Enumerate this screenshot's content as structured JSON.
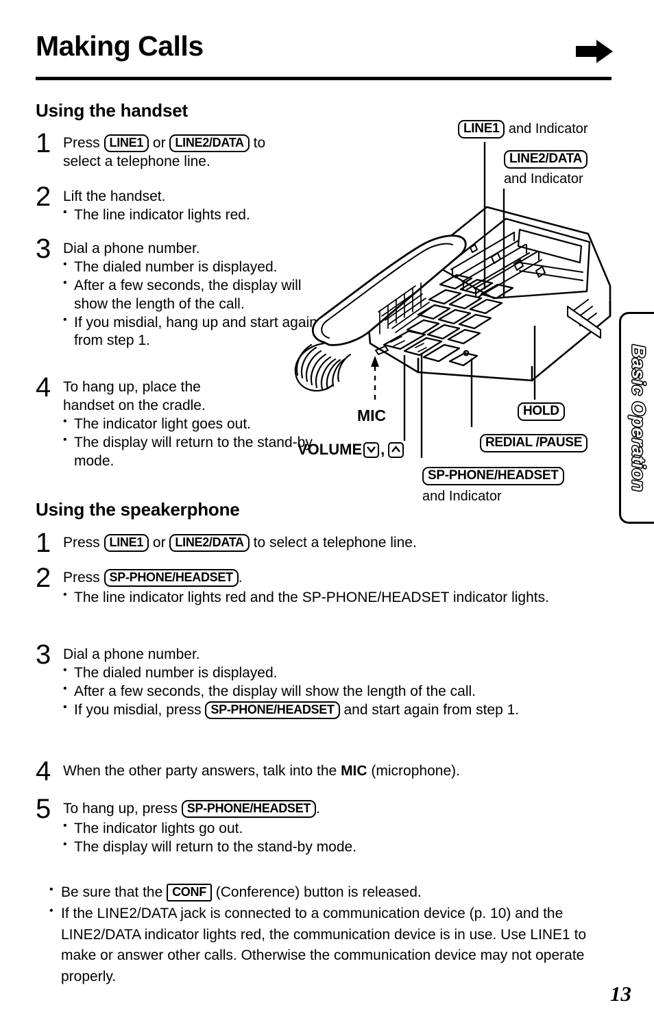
{
  "page": {
    "title": "Making Calls",
    "number": "13",
    "arrow_icon": "right-arrow-icon",
    "side_tab_label": "Basic Operation"
  },
  "handset": {
    "heading": "Using the handset",
    "steps": [
      {
        "num": "1",
        "line1_a": "Press",
        "key1": "LINE1",
        "line1_b": "or",
        "key2": "LINE2/DATA",
        "line1_c": "to",
        "line2": "select a telephone line.",
        "bullets": []
      },
      {
        "num": "2",
        "text": "Lift the handset.",
        "bullets": [
          "The line indicator lights red."
        ]
      },
      {
        "num": "3",
        "text": "Dial a phone number.",
        "bullets": [
          "The dialed number is displayed.",
          "After a few seconds, the display will show the length of the call.",
          "If you misdial, hang up and start again from step 1."
        ]
      },
      {
        "num": "4",
        "text": "To hang up, place the handset on the cradle.",
        "bullets": [
          "The indicator light goes out.",
          "The display will return to the stand-by mode."
        ]
      }
    ]
  },
  "speakerphone": {
    "heading": "Using the speakerphone",
    "steps": [
      {
        "num": "1",
        "a": "Press",
        "key1": "LINE1",
        "b": "or",
        "key2": "LINE2/DATA",
        "c": "to select a telephone line.",
        "bullets": []
      },
      {
        "num": "2",
        "a": "Press",
        "key1": "SP-PHONE/HEADSET",
        "c": ".",
        "bullets": [
          "The line indicator lights red and the SP-PHONE/HEADSET indicator lights."
        ]
      },
      {
        "num": "3",
        "text": "Dial a phone number.",
        "bullets": [
          "The dialed number is displayed.",
          "After a few seconds, the display will show the length of the call."
        ],
        "bullet_with_key": {
          "a": "If you misdial, press",
          "key1": "SP-PHONE/HEADSET",
          "c": "and start again from step 1."
        }
      },
      {
        "num": "4",
        "text_a": "When the other party answers, talk into the",
        "bold": "MIC",
        "text_b": "(microphone).",
        "bullets": []
      },
      {
        "num": "5",
        "a": "To hang up, press",
        "key1": "SP-PHONE/HEADSET",
        "c": ".",
        "bullets": [
          "The indicator lights go out.",
          "The display will return to the stand-by mode."
        ]
      }
    ]
  },
  "notes": {
    "note1_a": "Be sure that the",
    "note1_key": "CONF",
    "note1_b": "(Conference) button is released.",
    "note2": "If the LINE2/DATA jack is connected to a communication device (p. 10) and the LINE2/DATA indicator lights red, the communication device is in use. Use LINE1 to make or answer other calls. Otherwise the communication device may not operate properly."
  },
  "diagram": {
    "callouts": {
      "line1_key": "LINE1",
      "line1_suffix": "and Indicator",
      "line2_key": "LINE2/DATA",
      "line2_suffix": "and Indicator",
      "mic": "MIC",
      "volume": "VOLUME",
      "volume_down_icon": "volume-down-icon",
      "volume_up_icon": "volume-up-icon",
      "hold_key": "HOLD",
      "redial_key": "REDIAL /PAUSE",
      "spphone_key": "SP-PHONE/HEADSET",
      "spphone_suffix": "and Indicator"
    },
    "device": "desk-telephone-illustration"
  }
}
